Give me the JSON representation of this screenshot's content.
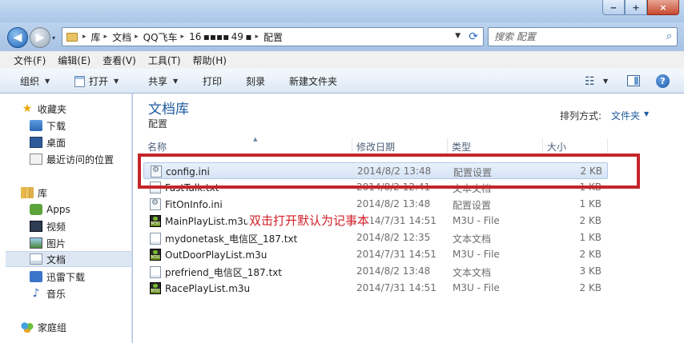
{
  "window": {
    "minimize_label": "‒",
    "maximize_label": "+",
    "close_label": "×"
  },
  "nav": {
    "back_label": "◀",
    "forward_label": "▶",
    "history_label": "▾"
  },
  "address": {
    "crumbs": [
      "库",
      "文档",
      "QQ飞车",
      "16 ▪▪▪▪ 49 ▪",
      "配置"
    ],
    "separator": "▸"
  },
  "search": {
    "placeholder": "搜索 配置"
  },
  "menu": [
    "文件(F)",
    "编辑(E)",
    "查看(V)",
    "工具(T)",
    "帮助(H)"
  ],
  "toolbar": {
    "organize": "组织",
    "open": "打开",
    "share": "共享",
    "print": "打印",
    "burn": "刻录",
    "new_folder": "新建文件夹",
    "dropdown": "▼",
    "views_icon": "☷",
    "help": "?"
  },
  "navpane": {
    "favorites": "收藏夹",
    "downloads": "下载",
    "desktop": "桌面",
    "recent": "最近访问的位置",
    "libraries": "库",
    "apps": "Apps",
    "videos": "视频",
    "pictures": "图片",
    "documents": "文档",
    "xunlei": "迅雷下载",
    "music": "音乐",
    "homegroup": "家庭组"
  },
  "library": {
    "title": "文档库",
    "subtitle": "配置",
    "arrange_label": "排列方式:",
    "arrange_value": "文件夹",
    "arrange_dd": "▼"
  },
  "columns": {
    "name": "名称",
    "modified": "修改日期",
    "type": "类型",
    "size": "大小",
    "sort_arrow": "▲"
  },
  "files": [
    {
      "name": "config.ini",
      "modified": "2014/8/2 13:48",
      "type": "配置设置",
      "size": "2 KB",
      "icon": "ini-icon"
    },
    {
      "name": "FastTalk.txt",
      "modified": "2014/8/2 12:41",
      "type": "文本文档",
      "size": "1 KB",
      "icon": "txt-icon"
    },
    {
      "name": "FitOnInfo.ini",
      "modified": "2014/8/2 13:48",
      "type": "配置设置",
      "size": "1 KB",
      "icon": "ini-icon"
    },
    {
      "name": "MainPlayList.m3u",
      "modified": "2014/7/31 14:51",
      "type": "M3U - File",
      "size": "2 KB",
      "icon": "m3u-icon"
    },
    {
      "name": "mydonetask_电信区_187.txt",
      "modified": "2014/8/2 12:35",
      "type": "文本文档",
      "size": "1 KB",
      "icon": "txt-icon"
    },
    {
      "name": "OutDoorPlayList.m3u",
      "modified": "2014/7/31 14:51",
      "type": "M3U - File",
      "size": "2 KB",
      "icon": "m3u-icon"
    },
    {
      "name": "prefriend_电信区_187.txt",
      "modified": "2014/8/2 13:48",
      "type": "文本文档",
      "size": "3 KB",
      "icon": "txt-icon"
    },
    {
      "name": "RacePlayList.m3u",
      "modified": "2014/7/31 14:51",
      "type": "M3U - File",
      "size": "2 KB",
      "icon": "m3u-icon"
    }
  ],
  "annotation": {
    "text": "双击打开默认为记事本",
    "color": "#c3252a"
  }
}
